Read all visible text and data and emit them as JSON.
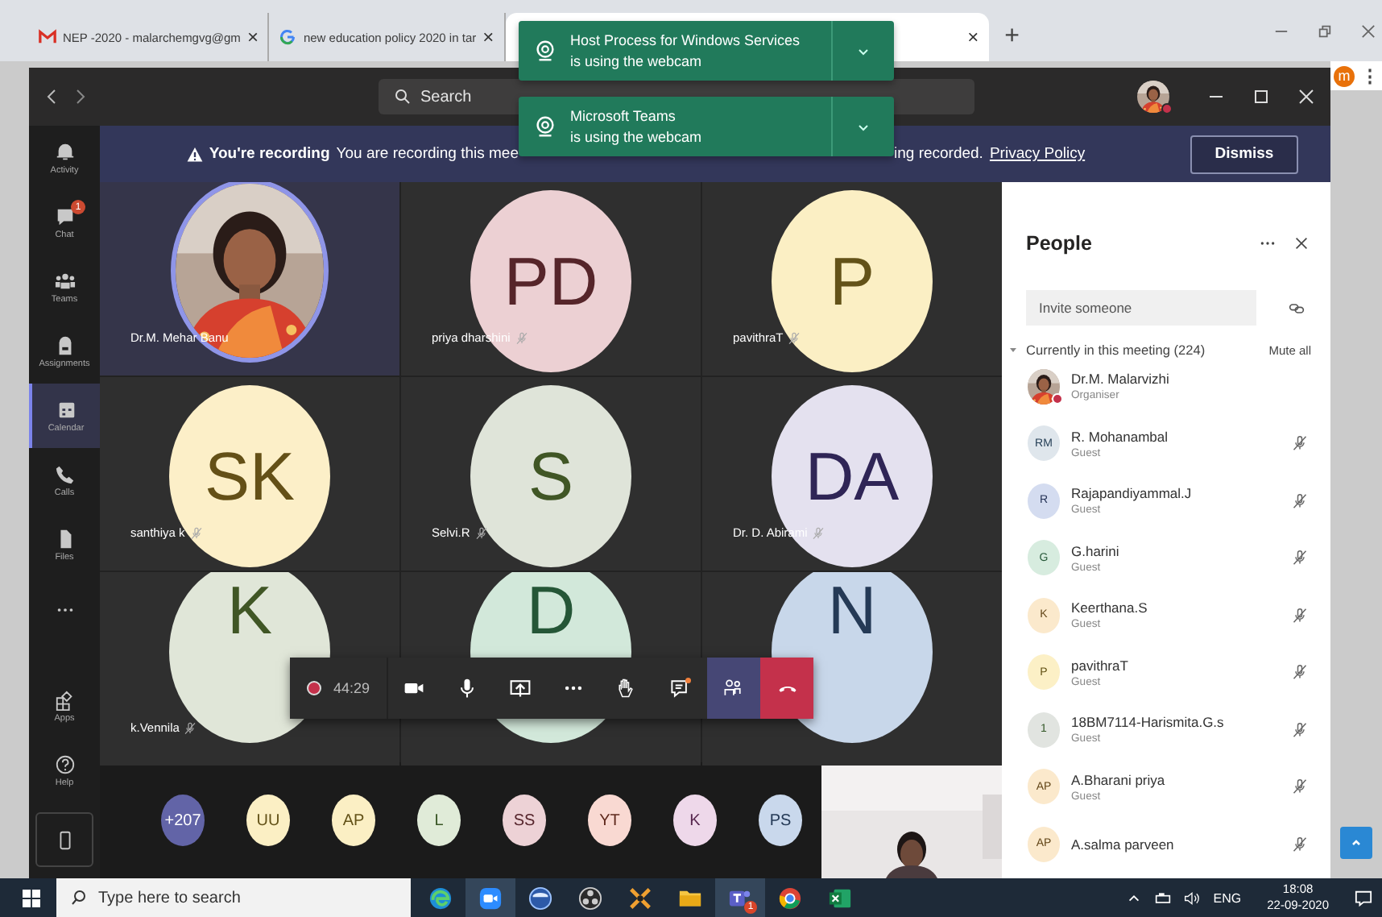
{
  "browser": {
    "tabs": [
      {
        "kind": "gmail",
        "title": "NEP -2020 - malarchemgvg@gm",
        "close": "×",
        "selected": false
      },
      {
        "kind": "google",
        "title": "new education policy 2020 in tar",
        "close": "×",
        "selected": false
      },
      {
        "kind": "plain",
        "close": "×",
        "selected": true
      }
    ],
    "new_tab": "+",
    "profile": "m",
    "menu": "⋮"
  },
  "toasts": [
    {
      "title": "Host Process for Windows Services",
      "text": "is using the webcam"
    },
    {
      "title": "Microsoft Teams",
      "text": "is using the webcam"
    }
  ],
  "teams": {
    "search": {
      "placeholder": "Search"
    },
    "rail": [
      {
        "kind": "bell",
        "label": "Activity",
        "selected": false
      },
      {
        "kind": "chat",
        "label": "Chat",
        "badge": "1",
        "selected": false
      },
      {
        "kind": "teams",
        "label": "Teams",
        "selected": false
      },
      {
        "kind": "bag",
        "label": "Assignments",
        "selected": false
      },
      {
        "kind": "calendar",
        "label": "Calendar",
        "selected": true
      },
      {
        "kind": "phone",
        "label": "Calls",
        "selected": false
      },
      {
        "kind": "file",
        "label": "Files",
        "selected": false
      },
      {
        "kind": "more",
        "selected": false
      },
      {
        "kind": "apps",
        "label": "Apps",
        "selected": false
      },
      {
        "kind": "help",
        "label": "Help",
        "selected": false
      },
      {
        "kind": "device",
        "selected": false
      }
    ],
    "banner": {
      "title": "You're recording",
      "text_before": "You are recording this mee",
      "text_after": "ing recorded.",
      "link": "Privacy Policy",
      "button": "Dismiss"
    },
    "tiles": [
      {
        "name": "Dr.M. Mehar Banu",
        "speaking": true,
        "muted": false
      },
      {
        "kind": "initials",
        "initials": "PD",
        "color": "#ecd0d3",
        "name": "priya dharshini",
        "speaking": false,
        "muted": true
      },
      {
        "kind": "initials",
        "initials": "P",
        "color": "#fbefc4",
        "name": "pavithraT",
        "speaking": false,
        "muted": true
      },
      {
        "kind": "initials",
        "initials": "SK",
        "color": "#fcefc8",
        "name": "santhiya k",
        "speaking": false,
        "muted": true
      },
      {
        "kind": "initials",
        "initials": "S",
        "color": "#dfe4d9",
        "name": "Selvi.R",
        "speaking": false,
        "muted": true
      },
      {
        "kind": "initials",
        "initials": "DA",
        "color": "#e4e1ef",
        "name": "Dr. D. Abirami",
        "speaking": false,
        "muted": true
      },
      {
        "kind": "initials",
        "initials": "K",
        "color": "#e0e6d8",
        "name": "k.Vennila",
        "speaking": false,
        "muted": true
      },
      {
        "kind": "initials",
        "initials": "D",
        "color": "#d2e8da",
        "speaking": false,
        "muted": false
      },
      {
        "kind": "initials",
        "initials": "N",
        "color": "#c8d7ea",
        "speaking": false,
        "muted": false
      }
    ],
    "controls": {
      "timer": "44:29",
      "recording": true,
      "buttons": [
        {
          "kind": "camera",
          "selected": false,
          "notification": false
        },
        {
          "kind": "mic",
          "selected": false,
          "notification": false
        },
        {
          "kind": "share",
          "selected": false,
          "notification": false
        },
        {
          "kind": "more",
          "selected": false,
          "notification": false
        },
        {
          "kind": "hand",
          "selected": false,
          "notification": false
        },
        {
          "kind": "chat",
          "selected": false,
          "notification": true
        },
        {
          "kind": "people",
          "selected": true,
          "notification": false
        },
        {
          "kind": "hangup",
          "selected": false,
          "notification": false
        }
      ]
    },
    "strip": [
      {
        "initials": "+207",
        "color": "#6264a7"
      },
      {
        "initials": "UU",
        "color": "#fbefc4"
      },
      {
        "initials": "AP",
        "color": "#fbefc4"
      },
      {
        "initials": "L",
        "color": "#e0ebd8"
      },
      {
        "initials": "SS",
        "color": "#edd2d6"
      },
      {
        "initials": "YT",
        "color": "#f9d9d2"
      },
      {
        "initials": "K",
        "color": "#eed8ea"
      },
      {
        "initials": "PS",
        "color": "#c9d8ec"
      }
    ],
    "people": {
      "title": "People",
      "invite_placeholder": "Invite someone",
      "section": "Currently in this meeting (224)",
      "expanded": true,
      "mute_all": "Mute all",
      "members": [
        {
          "name": "Dr.M. Malarvizhi",
          "role": "Organiser",
          "muted": false
        },
        {
          "kind": "initials",
          "initials": "RM",
          "color": "#dfe6ec",
          "name": "R. Mohanambal",
          "role": "Guest",
          "muted": true
        },
        {
          "kind": "initials",
          "initials": "R",
          "color": "#d4dcf0",
          "name": "Rajapandiyammal.J",
          "role": "Guest",
          "muted": true
        },
        {
          "kind": "initials",
          "initials": "G",
          "color": "#d7ecdf",
          "name": "G.harini",
          "role": "Guest",
          "muted": true
        },
        {
          "kind": "initials",
          "initials": "K",
          "color": "#fbe9cc",
          "name": "Keerthana.S",
          "role": "Guest",
          "muted": true
        },
        {
          "kind": "initials",
          "initials": "P",
          "color": "#fcf0c6",
          "name": "pavithraT",
          "role": "Guest",
          "muted": true
        },
        {
          "kind": "initials",
          "initials": "1",
          "color": "#e1e4e0",
          "name": "18BM7114-Harismita.G.s",
          "role": "Guest",
          "muted": true
        },
        {
          "kind": "initials",
          "initials": "AP",
          "color": "#fbe9cc",
          "name": "A.Bharani priya",
          "role": "Guest",
          "muted": true
        },
        {
          "kind": "initials",
          "initials": "AP",
          "color": "#fbe9cc",
          "name": "A.salma parveen",
          "muted": true
        }
      ]
    }
  },
  "taskbar": {
    "search_placeholder": "Type here to search",
    "apps": [
      {
        "kind": "edge",
        "selected": false
      },
      {
        "kind": "zoom",
        "selected": true
      },
      {
        "kind": "globe",
        "selected": false
      },
      {
        "kind": "obs",
        "selected": false
      },
      {
        "kind": "tool",
        "selected": false
      },
      {
        "kind": "folder",
        "selected": false
      },
      {
        "kind": "teams",
        "selected": true,
        "badge": "1"
      },
      {
        "kind": "chrome",
        "selected": false
      },
      {
        "kind": "excel",
        "selected": false
      }
    ],
    "language": "ENG",
    "time": "18:08",
    "date": "22-09-2020"
  }
}
